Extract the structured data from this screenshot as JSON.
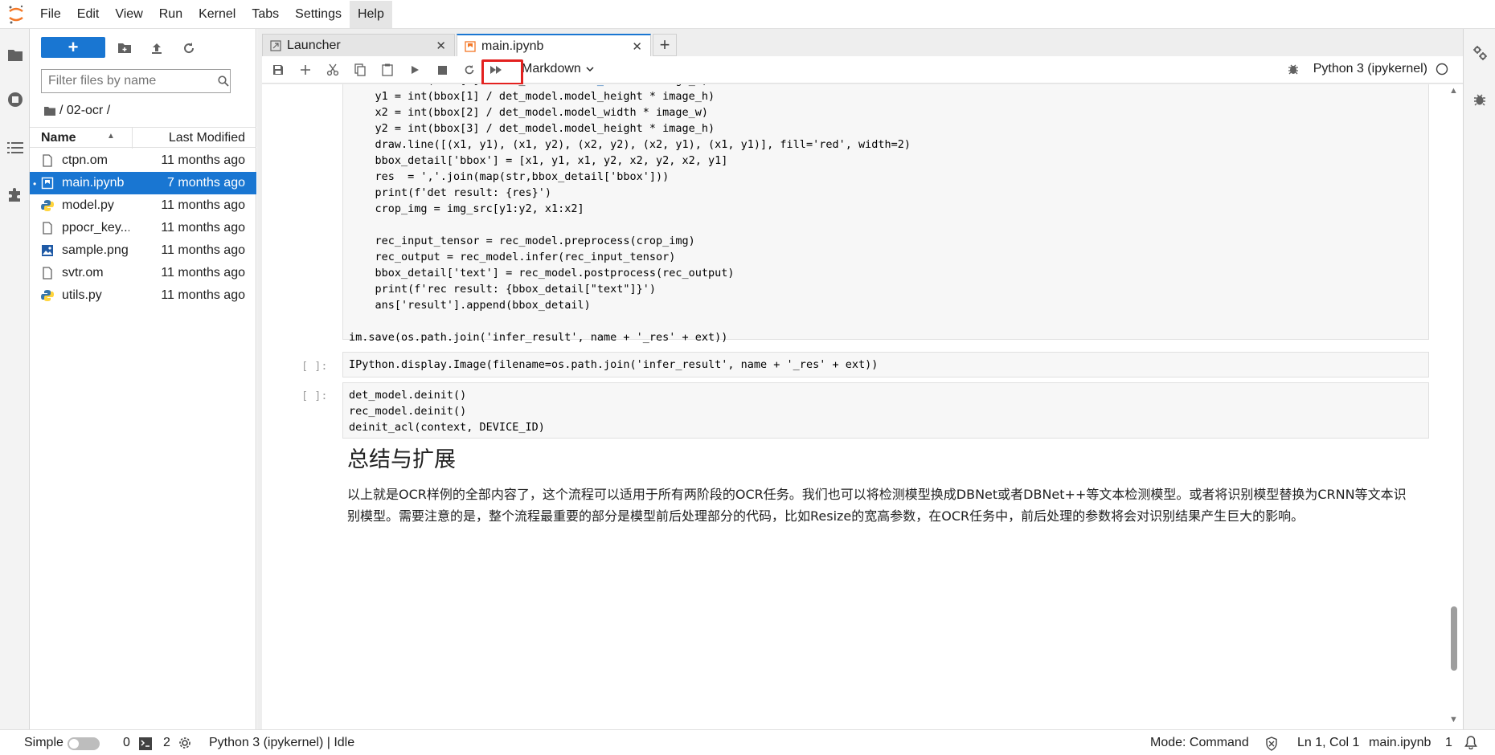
{
  "menu": {
    "items": [
      "File",
      "Edit",
      "View",
      "Run",
      "Kernel",
      "Tabs",
      "Settings",
      "Help"
    ],
    "active": "Help"
  },
  "filebrowser": {
    "new_label": "+",
    "search_placeholder": "Filter files by name",
    "breadcrumb": "/ 02-ocr /",
    "col_name": "Name",
    "col_modified": "Last Modified",
    "files": [
      {
        "name": "ctpn.om",
        "modified": "11 months ago",
        "icon": "file-icon",
        "selected": false
      },
      {
        "name": "main.ipynb",
        "modified": "7 months ago",
        "icon": "notebook-icon",
        "selected": true
      },
      {
        "name": "model.py",
        "modified": "11 months ago",
        "icon": "python-icon",
        "selected": false
      },
      {
        "name": "ppocr_key...",
        "modified": "11 months ago",
        "icon": "file-icon",
        "selected": false
      },
      {
        "name": "sample.png",
        "modified": "11 months ago",
        "icon": "image-icon",
        "selected": false
      },
      {
        "name": "svtr.om",
        "modified": "11 months ago",
        "icon": "file-icon",
        "selected": false
      },
      {
        "name": "utils.py",
        "modified": "11 months ago",
        "icon": "python-icon",
        "selected": false
      }
    ]
  },
  "tabs": [
    {
      "label": "Launcher"
    },
    {
      "label": "main.ipynb"
    }
  ],
  "toolbar": {
    "cell_type": "Markdown",
    "kernel": "Python 3 (ipykernel)"
  },
  "cells": {
    "cell1_lines": [
      "    y1 = int(bbox[1] / det_model.model_height * image_h)",
      "    x2 = int(bbox[2] / det_model.model_width * image_w)",
      "    y2 = int(bbox[3] / det_model.model_height * image_h)",
      "    draw.line([(x1, y1), (x1, y2), (x2, y2), (x2, y1), (x1, y1)], fill='red', width=2)",
      "    bbox_detail['bbox'] = [x1, y1, x1, y2, x2, y2, x2, y1]",
      "    res  = ','.join(map(str,bbox_detail['bbox']))",
      "    print(f'det result: {res}')",
      "    crop_img = img_src[y1:y2, x1:x2]",
      "",
      "    rec_input_tensor = rec_model.preprocess(crop_img)",
      "    rec_output = rec_model.infer(rec_input_tensor)",
      "    bbox_detail['text'] = rec_model.postprocess(rec_output)",
      "    print(f'rec result: {bbox_detail[\"text\"]}')",
      "    ans['result'].append(bbox_detail)",
      "",
      "im.save(os.path.join('infer_result', name + '_res' + ext))"
    ],
    "cell2_prompt": "[ ]:",
    "cell2_code": "IPython.display.Image(filename=os.path.join('infer_result', name + '_res' + ext))",
    "cell3_prompt": "[ ]:",
    "cell3_lines": [
      "det_model.deinit()",
      "rec_model.deinit()",
      "deinit_acl(context, DEVICE_ID)"
    ],
    "md_heading": "总结与扩展",
    "md_paragraph": "以上就是OCR样例的全部内容了，这个流程可以适用于所有两阶段的OCR任务。我们也可以将检测模型换成DBNet或者DBNet++等文本检测模型。或者将识别模型替换为CRNN等文本识别模型。需要注意的是，整个流程最重要的部分是模型前后处理部分的代码，比如Resize的宽高参数，在OCR任务中，前后处理的参数将会对识别结果产生巨大的影响。"
  },
  "statusbar": {
    "mode_label": "Simple",
    "terminals": "0",
    "kernels": "2",
    "kernel_status": "Python 3 (ipykernel) | Idle",
    "mode": "Mode: Command",
    "position": "Ln 1, Col 1",
    "filename": "main.ipynb",
    "notifications": "1"
  },
  "colors": {
    "accent": "#1976d2",
    "highlight": "#e3211f"
  }
}
